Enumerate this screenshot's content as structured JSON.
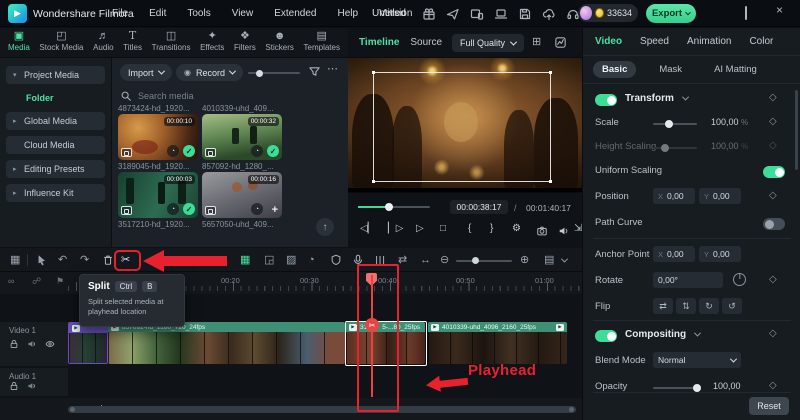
{
  "accent_color": "#4be3a4",
  "annotation_color": "#e8212f",
  "titlebar": {
    "app_name": "Wondershare Filmora",
    "menus": [
      "File",
      "Edit",
      "Tools",
      "View",
      "Extended",
      "Help",
      "Version"
    ],
    "project_title": "Untitled",
    "coin_count": "33634",
    "export_label": "Export",
    "close_glyph": "×"
  },
  "ribbon": {
    "tabs": [
      {
        "label": "Media",
        "icon": "▣"
      },
      {
        "label": "Stock Media",
        "icon": "◰"
      },
      {
        "label": "Audio",
        "icon": "♬"
      },
      {
        "label": "Titles",
        "icon": "T"
      },
      {
        "label": "Transitions",
        "icon": "◫"
      },
      {
        "label": "Effects",
        "icon": "✦"
      },
      {
        "label": "Filters",
        "icon": "❖"
      },
      {
        "label": "Stickers",
        "icon": "☻"
      },
      {
        "label": "Templates",
        "icon": "▤"
      }
    ]
  },
  "sidebar": {
    "items": [
      {
        "label": "Project Media",
        "caret": "▾"
      },
      {
        "label": "Folder"
      },
      {
        "label": "Global Media",
        "caret": "▸"
      },
      {
        "label": "Cloud Media",
        "caret": ""
      },
      {
        "label": "Editing Presets",
        "caret": "▸"
      },
      {
        "label": "Influence Kit",
        "caret": "▸"
      }
    ]
  },
  "media_panel": {
    "import_label": "Import",
    "record_label": "Record",
    "search_placeholder": "Search media",
    "row0_names": [
      "4873424-hd_1920...",
      "4010339-uhd_409..."
    ],
    "clips": [
      {
        "name": "3189045-hd_1920...",
        "duration": "00:00:10"
      },
      {
        "name": "857092-hd_1280_...",
        "duration": "00:00:32"
      },
      {
        "name": "3517210-hd_1920...",
        "duration": "00:00:03"
      },
      {
        "name": "5657050-uhd_409...",
        "duration": "00:00:16"
      }
    ]
  },
  "preview": {
    "tab_timeline": "Timeline",
    "tab_source": "Source",
    "quality": "Full Quality",
    "timecode_current": "00:00:38:17",
    "timecode_separator": "/",
    "timecode_total": "00:01:40:17"
  },
  "properties": {
    "tabs": [
      {
        "label": "Video"
      },
      {
        "label": "Speed"
      },
      {
        "label": "Animation"
      },
      {
        "label": "Color"
      }
    ],
    "subtabs": [
      {
        "label": "Basic"
      },
      {
        "label": "Mask"
      },
      {
        "label": "AI Matting"
      }
    ],
    "transform_label": "Transform",
    "scale": {
      "label": "Scale",
      "value": "100,00",
      "unit": "%"
    },
    "height_scaling": {
      "label": "Height Scaling",
      "value": "100,00",
      "unit": "%"
    },
    "uniform_scaling_label": "Uniform Scaling",
    "position": {
      "label": "Position",
      "x_prefix": "X",
      "x": "0,00",
      "y_prefix": "Y",
      "y": "0,00"
    },
    "path_curve_label": "Path Curve",
    "anchor_point": {
      "label": "Anchor Point",
      "x_prefix": "X",
      "x": "0,00",
      "y_prefix": "Y",
      "y": "0,00"
    },
    "rotate": {
      "label": "Rotate",
      "value": "0,00°"
    },
    "flip_label": "Flip",
    "flip_glyphs": [
      "⇄",
      "⇅",
      "↻",
      "↺"
    ],
    "compositing_label": "Compositing",
    "blend_mode": {
      "label": "Blend Mode",
      "value": "Normal"
    },
    "opacity": {
      "label": "Opacity",
      "value": "100,00"
    },
    "reset_label": "Reset"
  },
  "timeline": {
    "ruler_labels": [
      "00:20",
      "00:30",
      "00:40",
      "00:50",
      "01:00"
    ],
    "tracks": [
      {
        "name": "Video 1"
      },
      {
        "name": "Audio 1"
      }
    ],
    "clips": [
      {
        "name": "857092-hd_1280_720_24fps"
      },
      {
        "name_left": "31",
        "name_right": "5-...80_25fps"
      },
      {
        "name": "4010339-uhd_4096_2160_25fps"
      }
    ],
    "tooltip": {
      "title": "Split",
      "keys": [
        "Ctrl",
        "B"
      ],
      "description": "Split selected media at playhead location"
    },
    "playhead_label": "Playhead"
  },
  "icons": {
    "tools_grid": "▦",
    "undo": "↶",
    "redo": "↷",
    "split": "✂",
    "ai_copilot": "☻",
    "ai_chip": "▦",
    "frame_export": "◲",
    "image_tool": "▨",
    "speed_tool": "◔",
    "mixer": "☰",
    "ripple": "⇄",
    "fit": "↔",
    "zoom_out": "⊖",
    "zoom_in": "⊕",
    "track_height": "▤",
    "link": "∞",
    "snap": "☍",
    "marker": "⚑",
    "step_back": "◁▏",
    "step_forward": "▏▷",
    "play": "▷",
    "stop": "□",
    "mark_in": "{",
    "mark_out": "}",
    "settings": "⚙",
    "expand": "⇲",
    "record": "◉",
    "more": "⋯",
    "scroll_up": "↑",
    "add_track": "+",
    "check": "✓",
    "plus": "+",
    "grid_view": "⊞",
    "logo_play": "▶"
  }
}
